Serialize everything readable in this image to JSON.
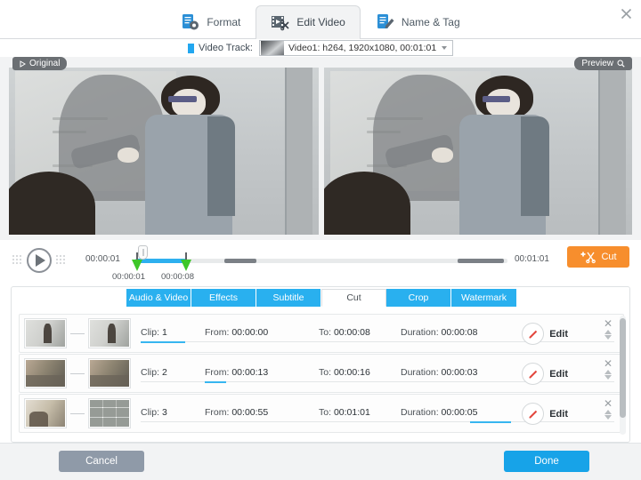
{
  "window": {
    "close_icon": "close-icon"
  },
  "tabs": [
    {
      "label": "Format",
      "icon": "format-icon",
      "active": false
    },
    {
      "label": "Edit Video",
      "icon": "edit-video-icon",
      "active": true
    },
    {
      "label": "Name & Tag",
      "icon": "name-tag-icon",
      "active": false
    }
  ],
  "track": {
    "label": "Video Track:",
    "selected": "Video1: h264, 1920x1080, 00:01:01",
    "caret_icon": "chevron-down-icon"
  },
  "preview": {
    "left_tag": "Original",
    "right_tag": "Preview",
    "left_tag_icon": "play-triangle-icon",
    "right_tag_icon": "magnifier-icon"
  },
  "transport": {
    "play_icon": "play-icon",
    "start_time": "00:00:01",
    "end_time": "00:01:01",
    "in_label": "00:00:01",
    "out_label": "00:00:08",
    "cut_label": "Cut",
    "cut_icon": "scissors-plus-icon"
  },
  "subtabs": [
    {
      "label": "Audio & Video",
      "active": false
    },
    {
      "label": "Effects",
      "active": false
    },
    {
      "label": "Subtitle",
      "active": false
    },
    {
      "label": "Cut",
      "active": true
    },
    {
      "label": "Crop",
      "active": false
    },
    {
      "label": "Watermark",
      "active": false
    }
  ],
  "clip_fields": {
    "clip": "Clip:",
    "from": "From:",
    "to": "To:",
    "duration": "Duration:",
    "edit": "Edit",
    "edit_icon": "pencil-icon",
    "remove_icon": "close-icon",
    "up_icon": "triangle-up-icon",
    "down_icon": "triangle-down-icon"
  },
  "clips": [
    {
      "index": "1",
      "from": "00:00:00",
      "to": "00:00:08",
      "duration": "00:00:08",
      "thumb_a": "tA",
      "thumb_b": "tA"
    },
    {
      "index": "2",
      "from": "00:00:13",
      "to": "00:00:16",
      "duration": "00:00:03",
      "thumb_a": "tB",
      "thumb_b": "tB"
    },
    {
      "index": "3",
      "from": "00:00:55",
      "to": "00:01:01",
      "duration": "00:00:05",
      "thumb_a": "tC",
      "thumb_b": "tD"
    }
  ],
  "footer": {
    "cancel": "Cancel",
    "done": "Done"
  },
  "colors": {
    "accent_blue": "#29b0ef",
    "done_blue": "#17a3e8",
    "cut_orange": "#f78e2d",
    "handle_green": "#3ec728",
    "cancel_gray": "#8f9aa8"
  }
}
